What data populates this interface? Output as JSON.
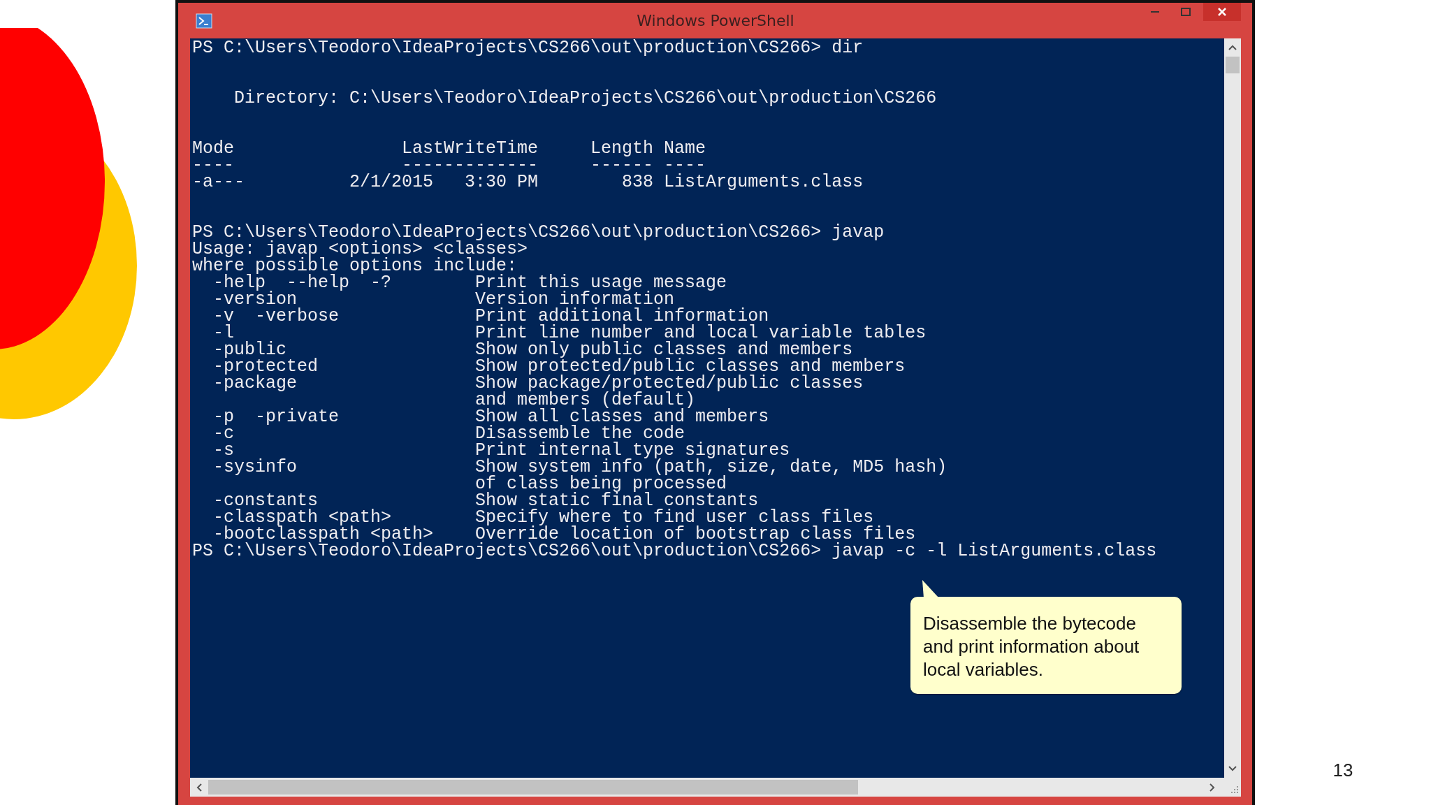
{
  "window": {
    "title": "Windows PowerShell"
  },
  "console": {
    "blocks": [
      {
        "lines": [
          "PS C:\\Users\\Teodoro\\IdeaProjects\\CS266\\out\\production\\CS266> dir"
        ]
      },
      {
        "lines": [
          "    Directory: C:\\Users\\Teodoro\\IdeaProjects\\CS266\\out\\production\\CS266"
        ]
      },
      {
        "lines": [
          "Mode                LastWriteTime     Length Name",
          "----                -------------     ------ ----",
          "-a---          2/1/2015   3:30 PM        838 ListArguments.class"
        ]
      },
      {
        "lines": [
          "PS C:\\Users\\Teodoro\\IdeaProjects\\CS266\\out\\production\\CS266> javap",
          "Usage: javap <options> <classes>",
          "where possible options include:",
          "  -help  --help  -?        Print this usage message",
          "  -version                 Version information",
          "  -v  -verbose             Print additional information",
          "  -l                       Print line number and local variable tables",
          "  -public                  Show only public classes and members",
          "  -protected               Show protected/public classes and members",
          "  -package                 Show package/protected/public classes",
          "                           and members (default)",
          "  -p  -private             Show all classes and members",
          "  -c                       Disassemble the code",
          "  -s                       Print internal type signatures",
          "  -sysinfo                 Show system info (path, size, date, MD5 hash)",
          "                           of class being processed",
          "  -constants               Show static final constants",
          "  -classpath <path>        Specify where to find user class files",
          "  -bootclasspath <path>    Override location of bootstrap class files",
          "PS C:\\Users\\Teodoro\\IdeaProjects\\CS266\\out\\production\\CS266> javap -c -l ListArguments.class"
        ]
      }
    ]
  },
  "callout": {
    "lines": [
      "Disassemble the bytecode",
      "and print information about",
      "local variables."
    ]
  },
  "slide": {
    "page_number": "13"
  }
}
